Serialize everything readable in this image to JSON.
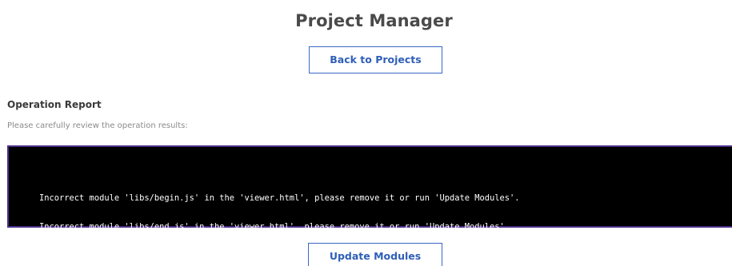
{
  "header": {
    "title": "Project Manager"
  },
  "nav": {
    "back_label": "Back to Projects"
  },
  "report": {
    "title": "Operation Report",
    "subtitle": "Please carefully review the operation results:",
    "lines": [
      "Incorrect module 'libs/begin.js' in the 'viewer.html', please remove it or run 'Update Modules'.",
      "Incorrect module 'libs/end.js' in the 'viewer.html', please remove it or run 'Update Modules'."
    ]
  },
  "actions": {
    "update_label": "Update Modules"
  },
  "colors": {
    "accent": "#3a67c2",
    "console_bg": "#000000",
    "console_border": "#4b2f8a",
    "title_text": "#4a4a4a"
  }
}
